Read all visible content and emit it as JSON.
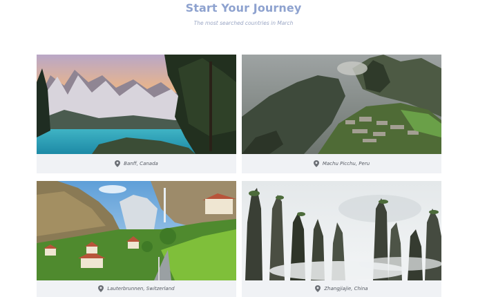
{
  "header": {
    "title": "Start Your Journey",
    "subtitle": "The most searched countries in March"
  },
  "colors": {
    "title": "#8ea2cf",
    "card_bg": "#eef1f4",
    "caption_text": "#555a63",
    "pin": "#6b6f75"
  },
  "destinations": [
    {
      "caption": "Banff, Canada",
      "icon": "location-pin-icon"
    },
    {
      "caption": "Machu Picchu, Peru",
      "icon": "location-pin-icon"
    },
    {
      "caption": "Lauterbrunnen, Switzerland",
      "icon": "location-pin-icon"
    },
    {
      "caption": "Zhangjiajie, China",
      "icon": "location-pin-icon"
    }
  ]
}
